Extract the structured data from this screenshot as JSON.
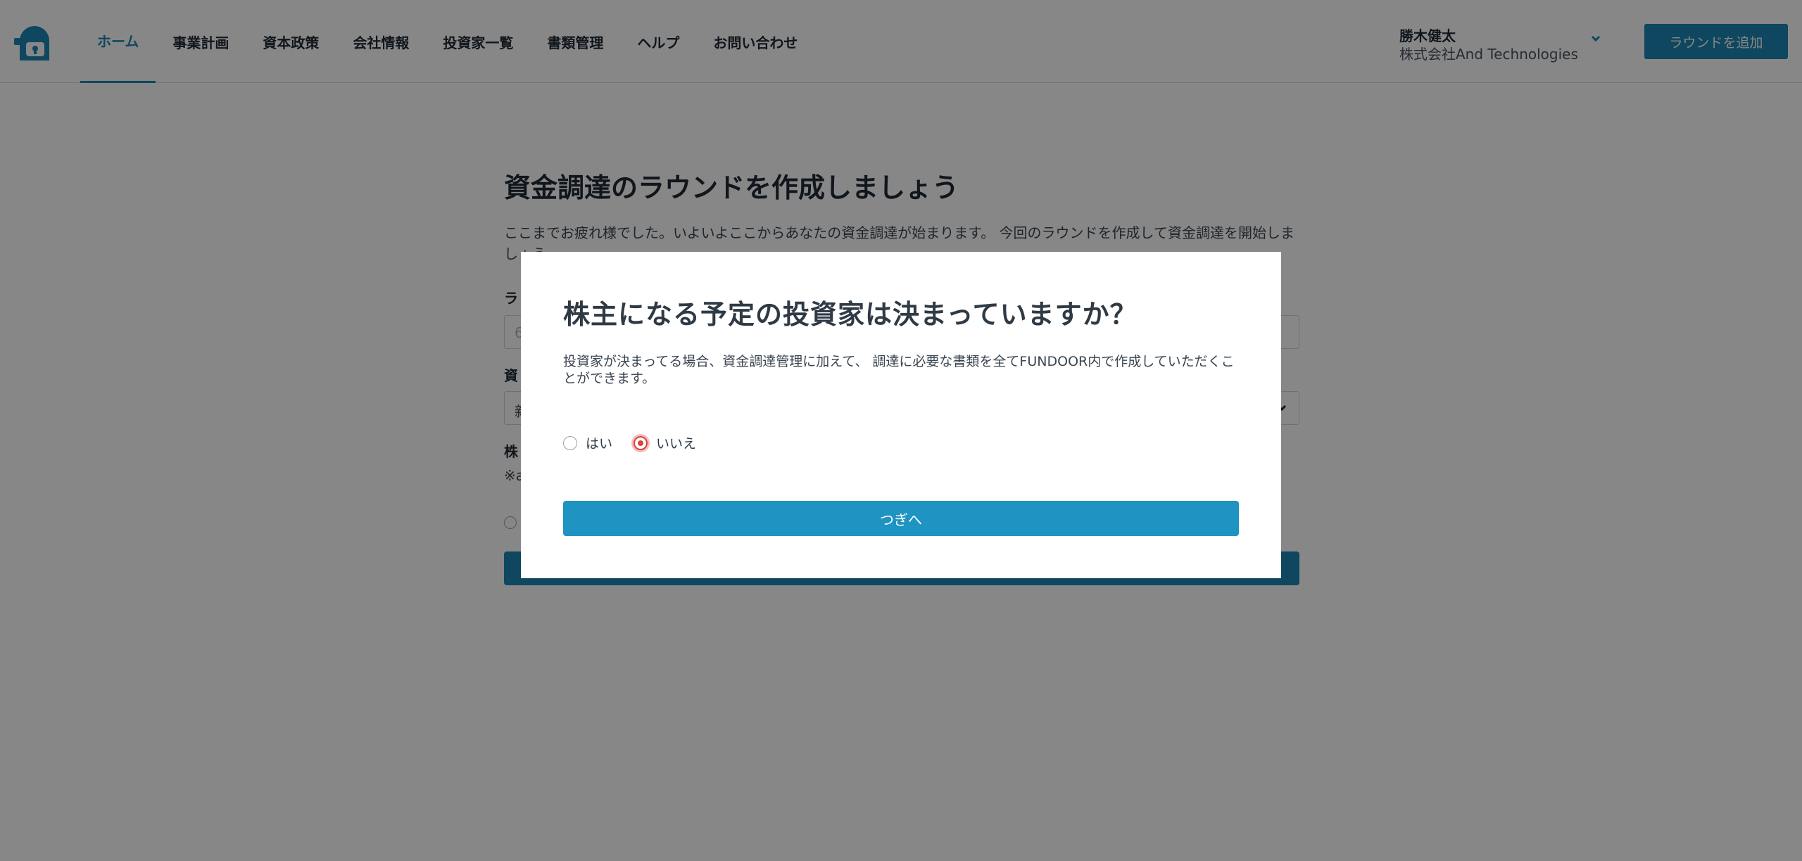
{
  "header": {
    "nav": [
      {
        "label": "ホーム",
        "active": true
      },
      {
        "label": "事業計画",
        "active": false
      },
      {
        "label": "資本政策",
        "active": false
      },
      {
        "label": "会社情報",
        "active": false
      },
      {
        "label": "投資家一覧",
        "active": false
      },
      {
        "label": "書類管理",
        "active": false
      },
      {
        "label": "ヘルプ",
        "active": false
      },
      {
        "label": "お問い合わせ",
        "active": false
      }
    ],
    "user": {
      "name": "勝木健太",
      "company": "株式会社And Technologies"
    },
    "add_round_label": "ラウンドを追加"
  },
  "form": {
    "title": "資金調達のラウンドを作成しましょう",
    "intro": "ここまでお疲れ様でした。いよいよここからあなたの資金調達が始まります。 今回のラウンドを作成して資金調達を開始しましょう。",
    "label_1": "ラ",
    "placeholder_1": "6",
    "label_2": "資",
    "value_2": "新",
    "label_3": "株",
    "note": "※a"
  },
  "modal": {
    "title": "株主になる予定の投資家は決まっていますか？",
    "description": "投資家が決まってる場合、資金調達管理に加えて、 調達に必要な書類を全てFUNDOOR内で作成していただくことができます。",
    "options": [
      {
        "label": "はい",
        "checked": false
      },
      {
        "label": "いいえ",
        "checked": true
      }
    ],
    "next_label": "つぎへ"
  },
  "colors": {
    "brand": "#1b86b3",
    "button": "#1f93c2",
    "radio_checked": "#d9433d"
  },
  "icons": {
    "logo": "lock-face-logo-icon",
    "user_menu": "chevron-down-icon",
    "select_caret": "chevron-down-icon"
  }
}
